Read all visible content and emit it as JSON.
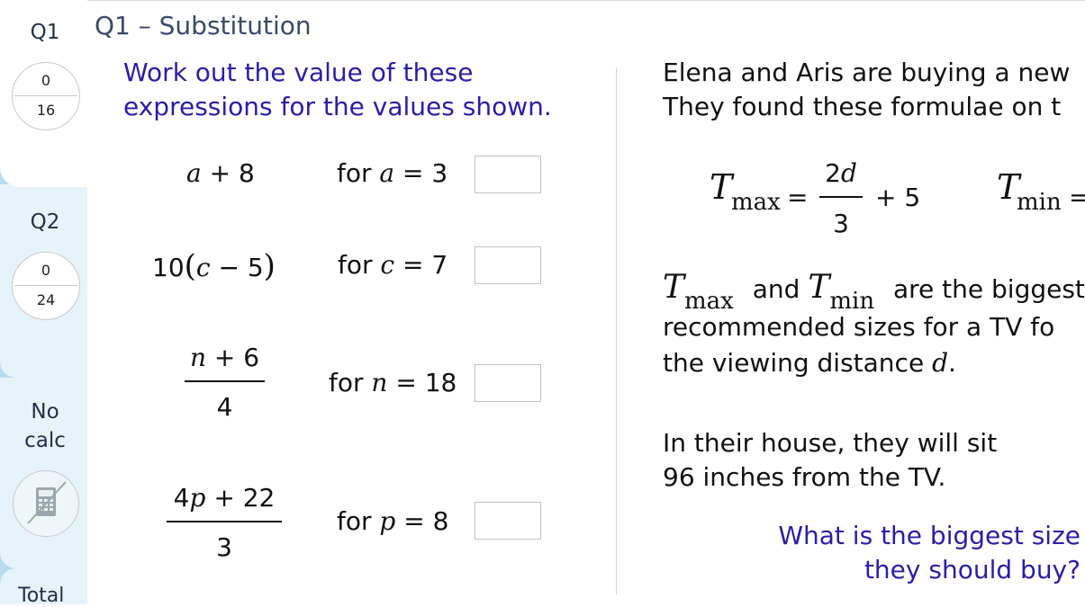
{
  "sidebar": {
    "q1": {
      "label": "Q1",
      "score": "0",
      "max": "16"
    },
    "q2": {
      "label": "Q2",
      "score": "0",
      "max": "24"
    },
    "no_calc": {
      "line1": "No",
      "line2": "calc"
    },
    "total_partial": "Total"
  },
  "question": {
    "header": "Q1 – Substitution",
    "instruction_line1": "Work out the value of these",
    "instruction_line2": "expressions for the values shown.",
    "items": [
      {
        "expr_var": "a",
        "expr_rest": " + 8",
        "for_label": "for",
        "var": "a",
        "eq": " = 3"
      },
      {
        "expr_prefix": "10",
        "expr_var": "c",
        "expr_rest": " − 5",
        "for_label": "for",
        "var": "c",
        "eq": " = 7"
      },
      {
        "num_var": "n",
        "num_rest": " + 6",
        "den": "4",
        "for_label": "for",
        "var": "n",
        "eq": " = 18"
      },
      {
        "num_prefix": "4",
        "num_var": "p",
        "num_rest": " + 22",
        "den": "3",
        "for_label": "for",
        "var": "p",
        "eq": " = 8"
      }
    ]
  },
  "context": {
    "line1": "Elena and Aris are buying a new",
    "line2": "They found these formulae on t",
    "formula_max": {
      "T": "T",
      "sub": "max",
      "eq": "=",
      "num": "2d",
      "den": "3",
      "rest": "+ 5"
    },
    "formula_min": {
      "T": "T",
      "sub": "min",
      "eq": "="
    },
    "desc_and": "and",
    "desc_rest": "are the biggest",
    "desc_line2": "recommended sizes for a TV fo",
    "desc_line3a": "the viewing distance",
    "desc_line3var": "d",
    "desc_line3end": ".",
    "house_line1": "In their house, they will sit",
    "house_line2": "96 inches from the TV.",
    "ask_line1": "What is the biggest size",
    "ask_line2": "they should buy?"
  },
  "colors": {
    "accent_text": "#2a1ea8",
    "sidebar_bg": "#b6dcee",
    "tab_bg": "#e7f3fa"
  }
}
